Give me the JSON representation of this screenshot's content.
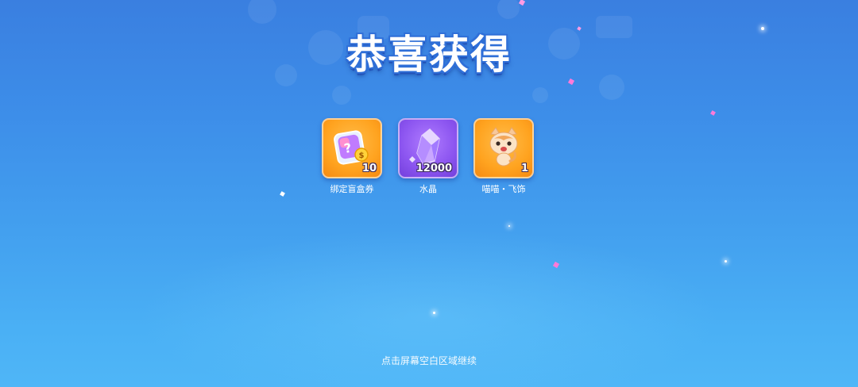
{
  "title": "恭喜获得",
  "rewards": [
    {
      "name": "绑定盲盒券",
      "quantity": "10",
      "icon": "blind-box-ticket-icon",
      "frame_color": "#ffa31f"
    },
    {
      "name": "水晶",
      "quantity": "12000",
      "icon": "crystal-icon",
      "frame_color": "#8c55f0"
    },
    {
      "name": "喵喵・飞饰",
      "quantity": "1",
      "icon": "cat-ornament-icon",
      "frame_color": "#ffa31f"
    }
  ],
  "footer": {
    "hint": "点击屏幕空白区域继续"
  },
  "colors": {
    "background_top": "#3a7fe0",
    "background_bottom": "#4fb6f7",
    "confetti": "#ff7ad9"
  }
}
